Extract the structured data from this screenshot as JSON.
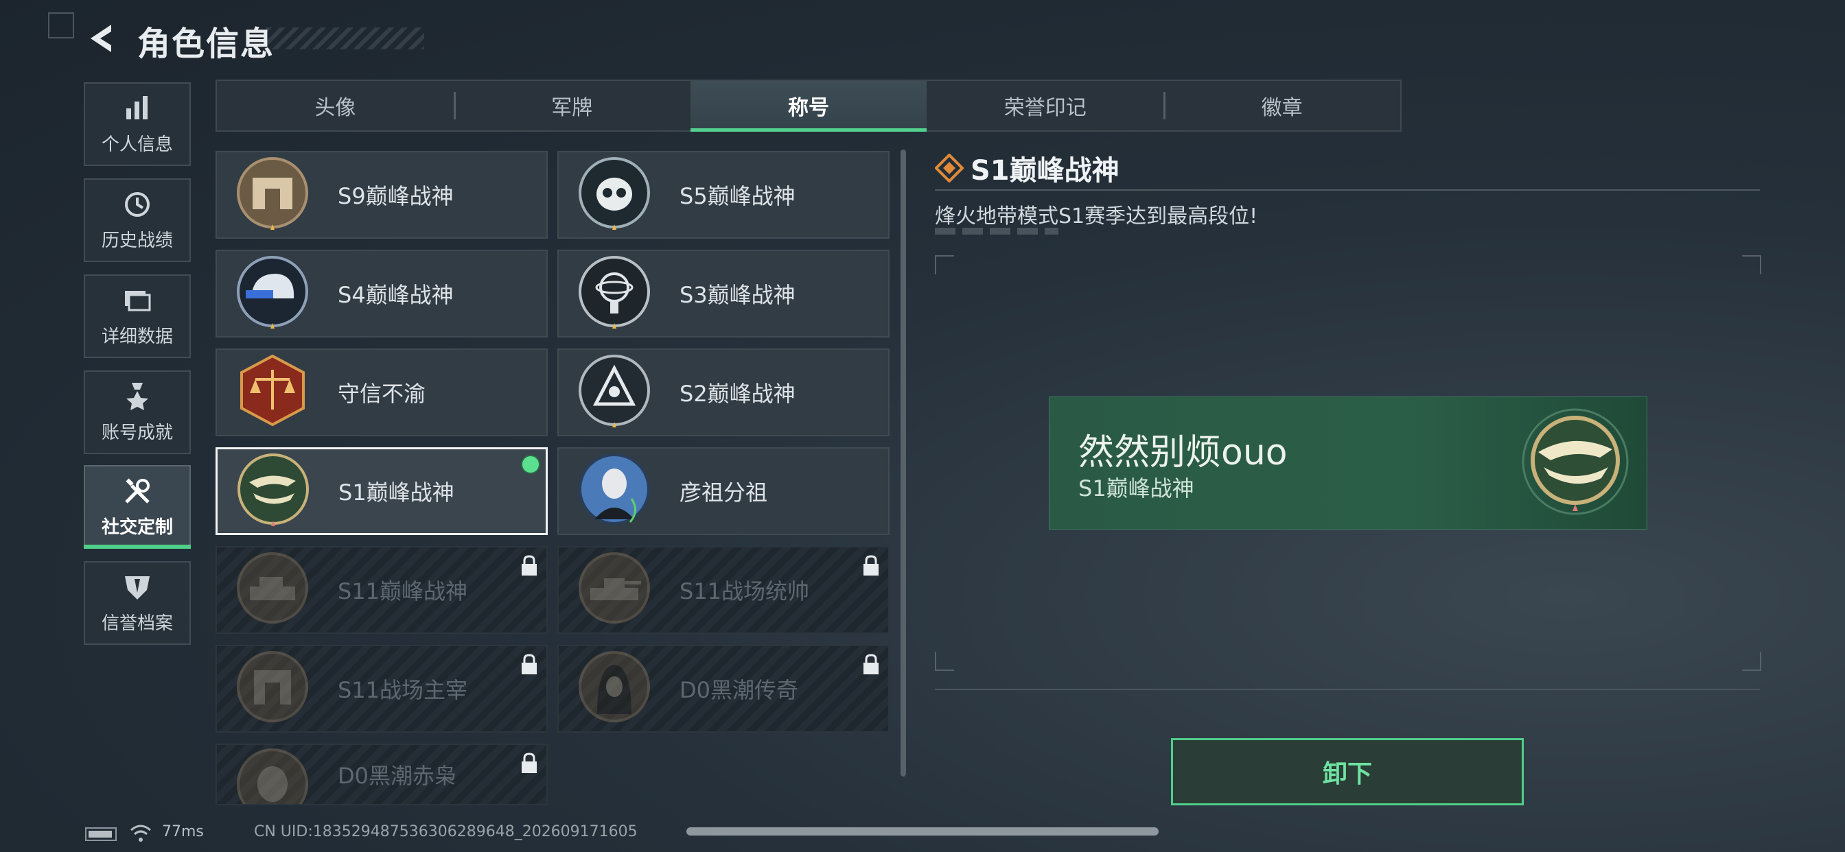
{
  "header": {
    "title": "角色信息"
  },
  "sidebar": {
    "items": [
      {
        "label": "个人信息",
        "icon": "bar-chart-icon"
      },
      {
        "label": "历史战绩",
        "icon": "history-clock-icon"
      },
      {
        "label": "详细数据",
        "icon": "folder-icon"
      },
      {
        "label": "账号成就",
        "icon": "medal-icon"
      },
      {
        "label": "社交定制",
        "icon": "wrench-screwdriver-icon",
        "active": true
      },
      {
        "label": "信誉档案",
        "icon": "shield-icon"
      }
    ]
  },
  "tabs": [
    {
      "label": "头像"
    },
    {
      "label": "军牌"
    },
    {
      "label": "称号",
      "active": true
    },
    {
      "label": "荣誉印记"
    },
    {
      "label": "徽章"
    }
  ],
  "titles": [
    {
      "name": "S9巅峰战神",
      "emblem": "arch-emblem",
      "locked": false
    },
    {
      "name": "S5巅峰战神",
      "emblem": "skull-emblem",
      "locked": false
    },
    {
      "name": "S4巅峰战神",
      "emblem": "helmet-emblem",
      "locked": false
    },
    {
      "name": "S3巅峰战神",
      "emblem": "globe-emblem",
      "locked": false
    },
    {
      "name": "守信不渝",
      "emblem": "scales-emblem",
      "locked": false
    },
    {
      "name": "S2巅峰战神",
      "emblem": "triangle-emblem",
      "locked": false
    },
    {
      "name": "S1巅峰战神",
      "emblem": "crocodile-emblem",
      "locked": false,
      "selected": true,
      "equipped": true
    },
    {
      "name": "彦祖分祖",
      "emblem": "portrait-emblem",
      "locked": false
    },
    {
      "name": "S11巅峰战神",
      "emblem": "tank-emblem",
      "locked": true
    },
    {
      "name": "S11战场统帅",
      "emblem": "tank-emblem",
      "locked": true
    },
    {
      "name": "S11战场主宰",
      "emblem": "arch-emblem",
      "locked": true
    },
    {
      "name": "D0黑潮传奇",
      "emblem": "hood-emblem",
      "locked": true
    },
    {
      "name": "D0黑潮赤枭",
      "emblem": "mask-emblem",
      "locked": true
    }
  ],
  "detail": {
    "title": "S1巅峰战神",
    "description": "烽火地带模式S1赛季达到最高段位!",
    "preview": {
      "player_name": "然然别烦ouo",
      "title": "S1巅峰战神"
    },
    "unequip_label": "卸下"
  },
  "footer": {
    "ping": "77ms",
    "uid": "CN UID:18352948753630628964​8_202609171605"
  },
  "colors": {
    "accent": "#4fd08a",
    "preview_bg": "#2a5a45"
  }
}
